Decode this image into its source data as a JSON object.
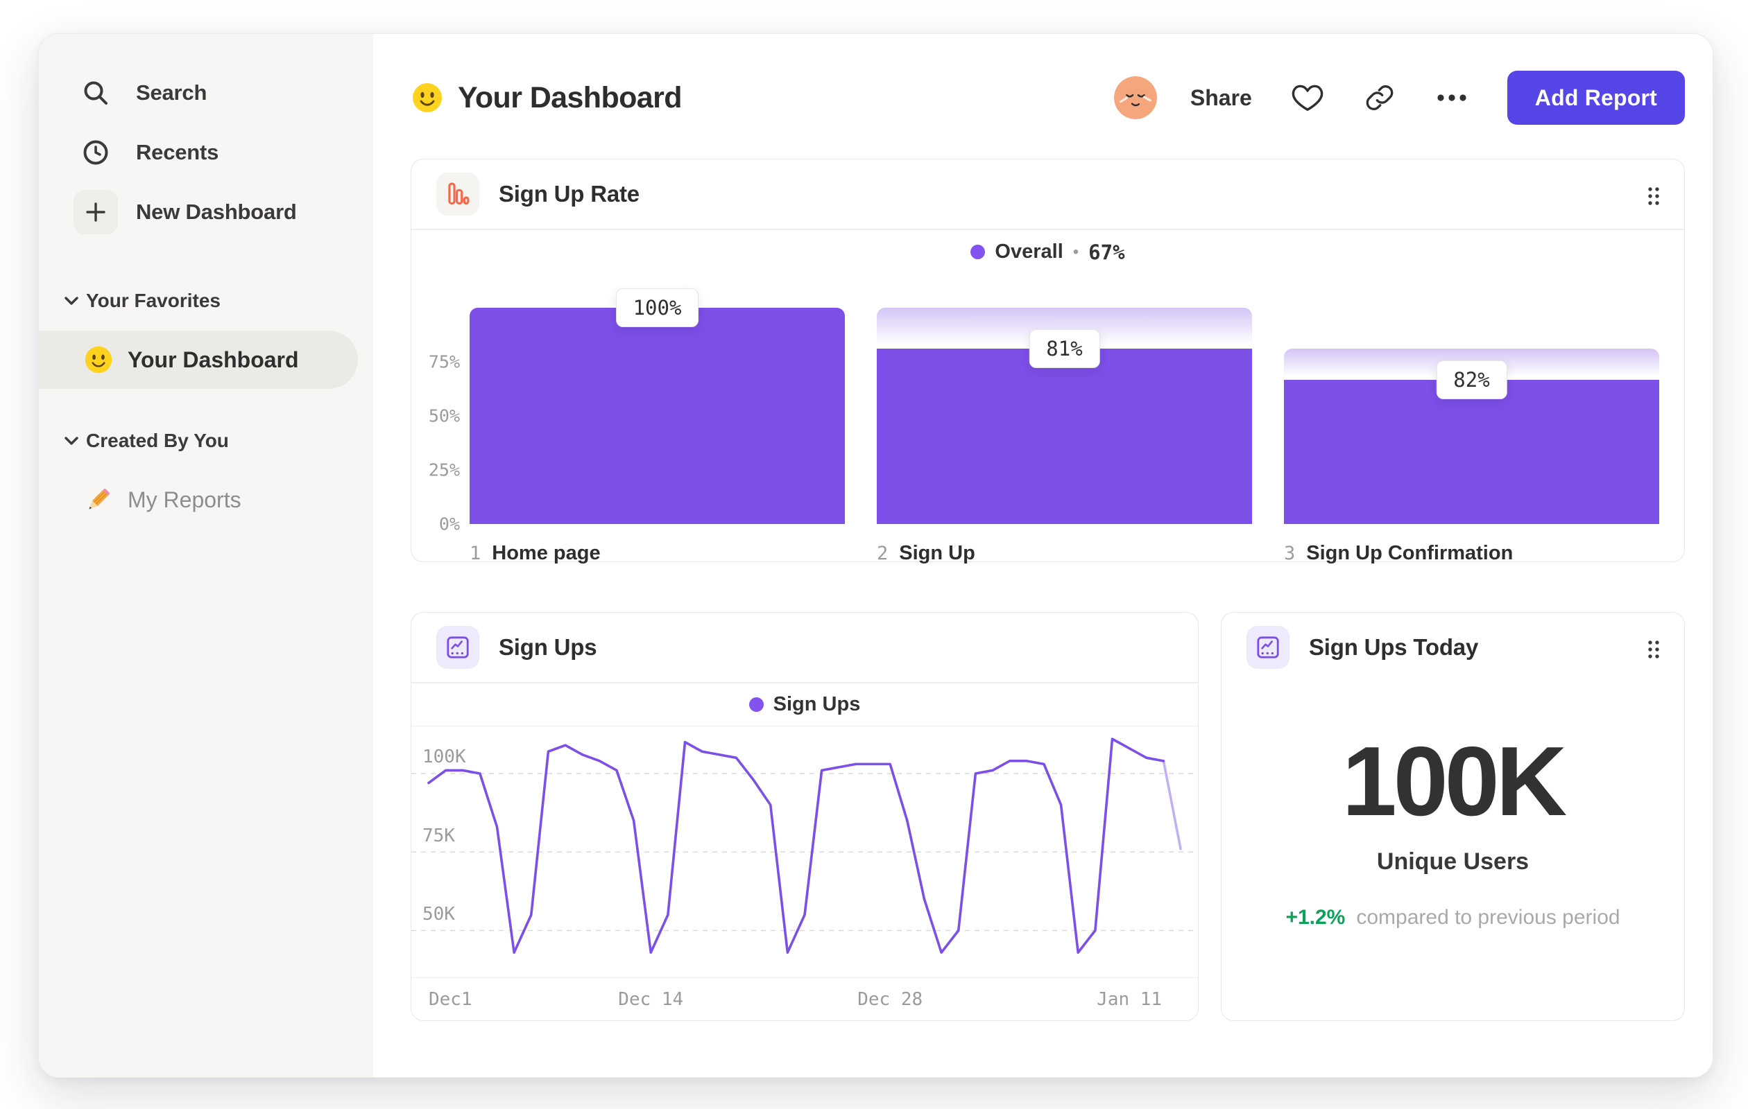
{
  "sidebar": {
    "search": "Search",
    "recents": "Recents",
    "new_dashboard": "New Dashboard",
    "favorites_header": "Your Favorites",
    "favorites_item": "Your Dashboard",
    "created_header": "Created By You",
    "created_item": "My Reports"
  },
  "header": {
    "title": "Your Dashboard",
    "share": "Share",
    "add_report": "Add Report"
  },
  "colors": {
    "accent_purple": "#7c4fe8",
    "legend_dot_purple": "#8352ef",
    "button_indigo": "#5646e8",
    "positive_green": "#0ba35a",
    "funnel_icon_orange": "#f26a4b"
  },
  "chart_data": [
    {
      "id": "sign_up_rate",
      "type": "funnel_bar",
      "title": "Sign Up Rate",
      "legend": {
        "series": "Overall",
        "separator": "•",
        "value": "67%"
      },
      "y_ticks": [
        "75%",
        "50%",
        "25%",
        "0%"
      ],
      "ylim": [
        "0%",
        "100%"
      ],
      "steps": [
        {
          "num": "1",
          "label": "Home page",
          "value_label": "100%",
          "total_pct": 100,
          "solid_pct": 100
        },
        {
          "num": "2",
          "label": "Sign Up",
          "value_label": "81%",
          "total_pct": 100,
          "solid_pct": 81
        },
        {
          "num": "3",
          "label": "Sign Up Confirmation",
          "value_label": "82%",
          "total_pct": 81,
          "solid_pct": 66.4
        }
      ]
    },
    {
      "id": "sign_ups",
      "type": "line",
      "title": "Sign Ups",
      "legend": {
        "series": "Sign Ups"
      },
      "unit": "K",
      "y_domain": [
        35,
        115
      ],
      "y_gridlines": [
        {
          "value": 100,
          "label": "100K"
        },
        {
          "value": 75,
          "label": "75K"
        },
        {
          "value": 50,
          "label": "50K"
        }
      ],
      "x_tick_labels": [
        {
          "label": "Dec1",
          "index": 0
        },
        {
          "label": "Dec 14",
          "index": 13
        },
        {
          "label": "Dec 28",
          "index": 27
        },
        {
          "label": "Jan 11",
          "index": 41
        }
      ],
      "values": [
        97,
        101,
        101,
        100,
        83,
        43,
        55,
        107,
        109,
        106,
        104,
        101,
        85,
        43,
        55,
        110,
        107,
        106,
        105,
        98,
        90,
        43,
        55,
        101,
        102,
        103,
        103,
        103,
        85,
        60,
        43,
        50,
        100,
        101,
        104,
        104,
        103,
        90,
        43,
        50,
        111,
        108,
        105,
        104,
        76
      ],
      "faded_tail_segments": 1
    },
    {
      "id": "sign_ups_today",
      "type": "kpi",
      "title": "Sign Ups Today",
      "value": "100K",
      "label": "Unique Users",
      "change": "+1.2%",
      "change_note": "compared to previous period"
    }
  ]
}
